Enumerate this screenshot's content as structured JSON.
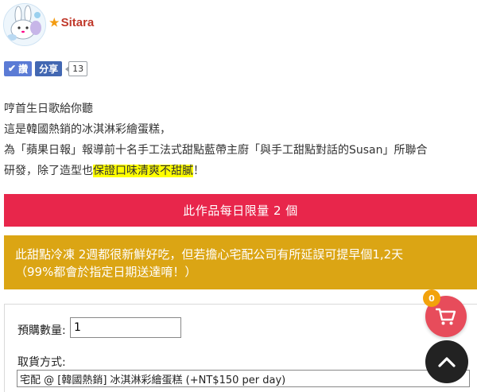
{
  "store": {
    "name": "Sitara",
    "star_icon": "star-icon",
    "star_color": "#f39c12",
    "name_color": "#c0392b"
  },
  "social": {
    "like_label": "讚",
    "share_label": "分享",
    "share_count": "13"
  },
  "description": {
    "line1": "哼首生日歌給你聽",
    "line2": "這是韓國熱銷的冰淇淋彩繪蛋糕，",
    "line3": "為「蘋果日報」報導前十名手工法式甜點藍帶主廚「與手工甜點對話的Susan」所聯合",
    "line4_pre": "研發，除了造型也",
    "line4_highlight": "保證口味清爽不甜膩",
    "line4_post": "！"
  },
  "banners": {
    "limit": "此作品每日限量 2 個",
    "shipping_line1": "此甜點冷凍 2週都很新鮮好吃，但若擔心宅配公司有所延誤可提早個1,2天",
    "shipping_line2": "（99%都會於指定日期送達唷！）"
  },
  "form": {
    "quantity_label": "預購數量:",
    "quantity_value": "1",
    "pickup_label": "取貨方式:",
    "pickup_selected": "宅配 @ [韓國熱銷] 冰淇淋彩繪蛋糕 (+NT$150 per day)"
  },
  "cart": {
    "count": "0"
  },
  "colors": {
    "red_banner": "#e8264b",
    "gold_banner": "#dba514",
    "cart_button": "#e74c5b",
    "badge": "#f2a20c"
  }
}
